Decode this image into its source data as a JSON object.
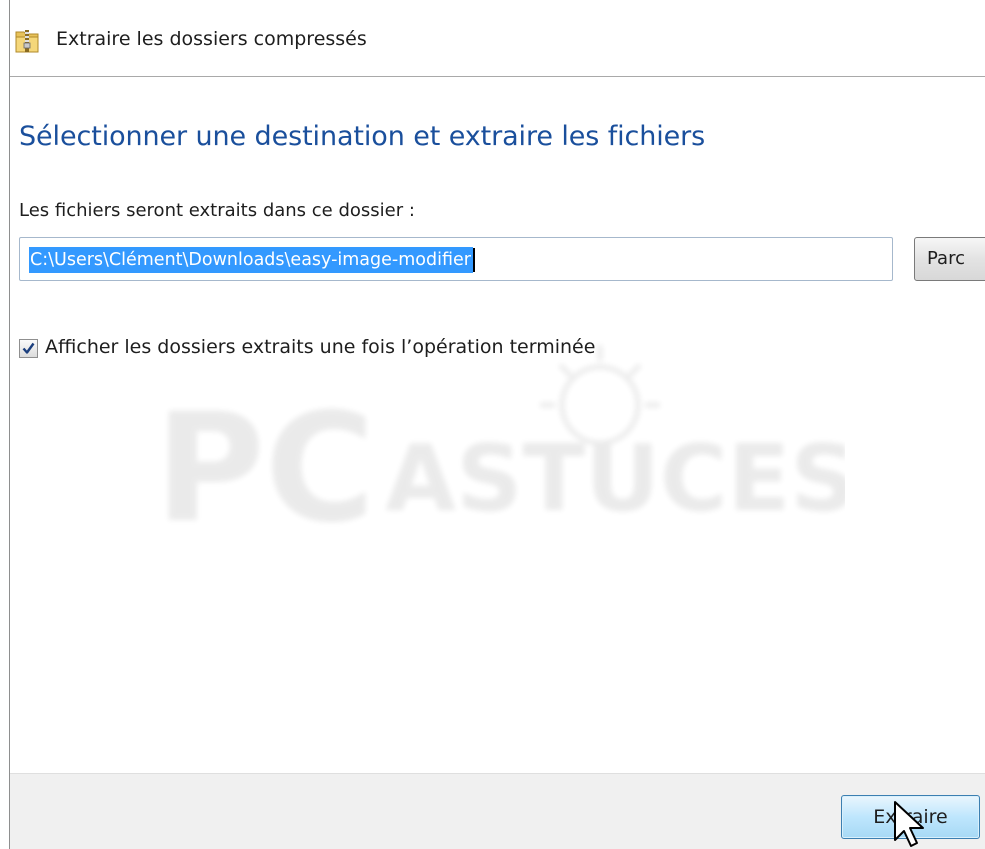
{
  "window": {
    "title": "Extraire les dossiers compressés"
  },
  "main": {
    "heading": "Sélectionner une destination et extraire les fichiers",
    "destination_label": "Les fichiers seront extraits dans ce dossier :",
    "destination_path": "C:\\Users\\Clément\\Downloads\\easy-image-modifier",
    "browse_label": "Parc",
    "show_folders_label": "Afficher les dossiers extraits une fois l’opération terminée",
    "show_folders_checked": true
  },
  "footer": {
    "extract_label": "Extraire"
  },
  "watermark": {
    "text_big": "PC",
    "text_small": "ASTUCES"
  },
  "colors": {
    "heading": "#1a4f9c",
    "selection": "#3399ff",
    "footer_bg": "#f0f0f0"
  }
}
